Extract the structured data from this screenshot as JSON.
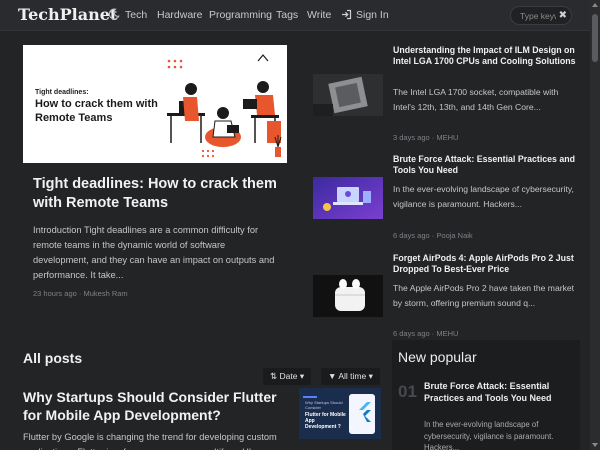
{
  "header": {
    "brand": "TechPlanet",
    "theme_icon": "moon-icon",
    "nav": [
      "Tech",
      "Hardware",
      "Programming",
      "Tags",
      "Write"
    ],
    "signin_label": "Sign In",
    "signin_icon": "sign-in-icon",
    "search_placeholder": "Type keyw",
    "search_clear": "✖"
  },
  "featured": {
    "image_tag": "Tight deadlines:",
    "image_title_line1": "How to crack them with",
    "image_title_line2": "Remote Teams",
    "title": "Tight deadlines: How to crack them with Remote Teams",
    "excerpt": "Introduction Tight deadlines are a common difficulty for remote teams in the dynamic world of software development, and they can have an impact on outputs and performance. It take...",
    "date": "23 hours ago",
    "author": "Mukesh Ram"
  },
  "side_articles": [
    {
      "title": "Understanding the Impact of ILM Design on Intel LGA 1700 CPUs and Cooling Solutions",
      "excerpt": "The Intel LGA 1700 socket, compatible with Intel's 12th, 13th, and 14th Gen Core...",
      "date": "3 days ago",
      "author": "MEHU"
    },
    {
      "title": "Brute Force Attack: Essential Practices and Tools You Need",
      "excerpt": "In the ever-evolving landscape of cybersecurity, vigilance is paramount. Hackers...",
      "date": "6 days ago",
      "author": "Pooja Naik"
    },
    {
      "title": "Forget AirPods 4: Apple AirPods Pro 2 Just Dropped To Best-Ever Price",
      "excerpt": "The Apple AirPods Pro 2 have taken the market by storm, offering premium sound q...",
      "date": "6 days ago",
      "author": "MEHU"
    }
  ],
  "all_posts": {
    "heading": "All posts",
    "sort_label": "Date",
    "range_label": "All time",
    "post": {
      "title": "Why Startups Should Consider Flutter for Mobile App Development?",
      "excerpt": "Flutter by Google is changing the trend for developing custom applications. Flutter is a free, open-source, multiform UI",
      "thumb_small": "Why Startups Should Consider",
      "thumb_text": "Flutter for Mobile App Development ?"
    }
  },
  "popular": {
    "heading": "New popular",
    "item": {
      "number": "01",
      "title": "Brute Force Attack: Essential Practices and Tools You Need",
      "excerpt": "In the ever-evolving landscape of cybersecurity, vigilance is paramount. Hackers..."
    }
  },
  "separator": "·",
  "colors": {
    "background": "#232426",
    "navbar": "#2a2b2e",
    "hero_accent": "#e8562d"
  }
}
